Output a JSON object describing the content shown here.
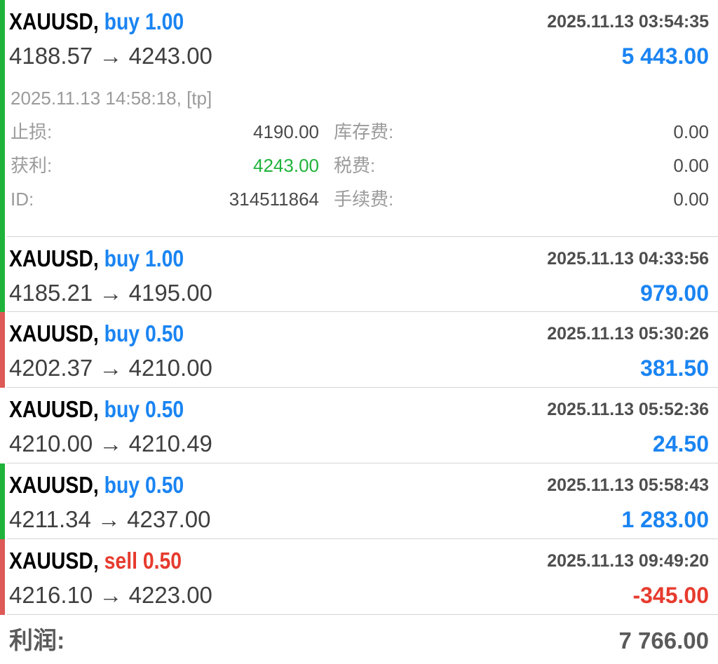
{
  "trades": [
    {
      "symbol": "XAUUSD",
      "sep": ",",
      "direction": "buy",
      "volume": "1.00",
      "open_time": "2025.11.13 03:54:35",
      "prices": "4188.57 → 4243.00",
      "profit": "5 443.00",
      "close_info": "2025.11.13 14:58:18, [tp]",
      "stop_loss_label": "止损:",
      "stop_loss": "4190.00",
      "take_profit_label": "获利:",
      "take_profit": "4243.00",
      "id_label": "ID:",
      "id": "314511864",
      "swap_label": "库存费:",
      "swap": "0.00",
      "taxes_label": "税费:",
      "taxes": "0.00",
      "commission_label": "手续费:",
      "commission": "0.00",
      "bar_color": "#1fb33b"
    },
    {
      "symbol": "XAUUSD",
      "sep": ",",
      "direction": "buy",
      "volume": "1.00",
      "open_time": "2025.11.13 04:33:56",
      "prices": "4185.21 → 4195.00",
      "profit": "979.00",
      "bar_color": "#1fb33b"
    },
    {
      "symbol": "XAUUSD",
      "sep": ",",
      "direction": "buy",
      "volume": "0.50",
      "open_time": "2025.11.13 05:30:26",
      "prices": "4202.37 → 4210.00",
      "profit": "381.50",
      "bar_color": "#dd5a56"
    },
    {
      "symbol": "XAUUSD",
      "sep": ",",
      "direction": "buy",
      "volume": "0.50",
      "open_time": "2025.11.13 05:52:36",
      "prices": "4210.00 → 4210.49",
      "profit": "24.50",
      "bar_color": "none"
    },
    {
      "symbol": "XAUUSD",
      "sep": ",",
      "direction": "buy",
      "volume": "0.50",
      "open_time": "2025.11.13 05:58:43",
      "prices": "4211.34 → 4237.00",
      "profit": "1 283.00",
      "bar_color": "#1fb33b"
    },
    {
      "symbol": "XAUUSD",
      "sep": ",",
      "direction": "sell",
      "volume": "0.50",
      "open_time": "2025.11.13 09:49:20",
      "prices": "4216.10 → 4223.00",
      "profit": "-345.00",
      "bar_color": "#dd5a56"
    }
  ],
  "footer": {
    "label": "利润:",
    "value": "7 766.00"
  },
  "colors": {
    "buy": "#1a84f2",
    "sell": "#e63b2e",
    "positive_profit": "#1a84f2",
    "negative_profit": "#e63b2e",
    "take_profit_value": "#1fb33b"
  }
}
